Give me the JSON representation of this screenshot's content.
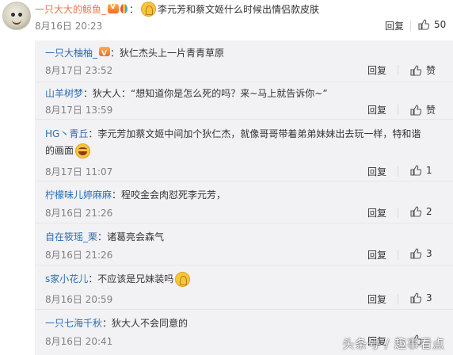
{
  "main_comment": {
    "username": "一只大大的鲸鱼_",
    "text": "李元芳和蔡文姬什么时候出情侣款皮肤",
    "time": "8月16日 20:23",
    "reply_label": "回复",
    "like_count": "50"
  },
  "replies": [
    {
      "username": "一只大柚柚_",
      "text": "狄仁杰头上一片青青草原",
      "time": "8月17日 23:52",
      "reply_label": "回复",
      "like_label": "赞",
      "emoji": false
    },
    {
      "username": "山羊树梦",
      "text": "狄大人：“想知道你是怎么死的吗？来~马上就告诉你~”",
      "time": "8月17日 13:59",
      "reply_label": "回复",
      "like_label": "赞",
      "emoji": false
    },
    {
      "username": "HG丶青丘",
      "text": "李元芳加蔡文姬中间加个狄仁杰，就像哥哥带着弟弟妹妹出去玩一样，特和谐的画面",
      "time": "8月17日 11:07",
      "reply_label": "回复",
      "like_label": "1",
      "emoji": true
    },
    {
      "username": "柠檬味儿婷麻麻",
      "text": "程咬金会肉怼死李元芳，",
      "time": "8月16日 21:26",
      "reply_label": "回复",
      "like_label": "2",
      "emoji": false
    },
    {
      "username": "自在筱瑶_栗",
      "text": "诸葛亮会森气",
      "time": "8月16日 21:26",
      "reply_label": "回复",
      "like_label": "3",
      "emoji": false
    },
    {
      "username": "s家小花儿",
      "text": "不应该是兄妹装吗",
      "time": "8月16日 20:59",
      "reply_label": "回复",
      "like_label": "3",
      "emoji": true
    },
    {
      "username": "一只七海千秋",
      "text": "狄大人不会同意的",
      "time": "8月16日 20:41",
      "reply_label": "回复",
      "like_label": "",
      "emoji": false
    }
  ],
  "watermark": "头条号 / 趣事看点",
  "icons": {
    "like": "thumbs-up-icon",
    "avatar": "avatar",
    "vip": "vip-badge-icon",
    "balloon": "balloon-icon",
    "pray_emoji": "pray-emoji-icon",
    "laugh_emoji": "laugh-emoji-icon"
  },
  "colors": {
    "username": "#eb7350",
    "reply_username": "#2a6fb2",
    "panel_bg": "#f2f2f5",
    "time": "#808080"
  }
}
